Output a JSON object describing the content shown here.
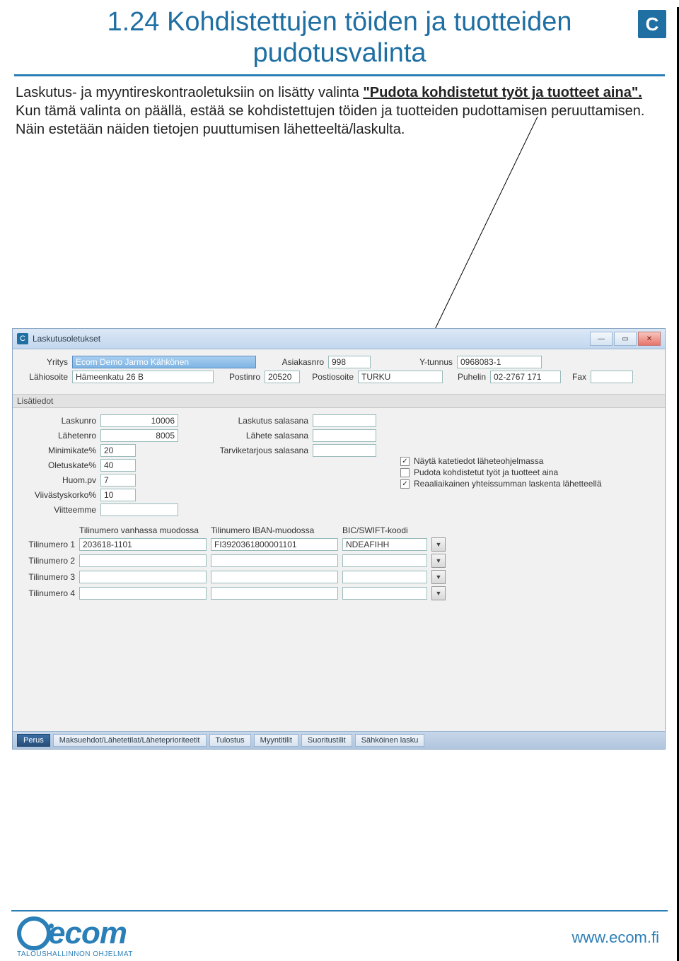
{
  "badge": "C",
  "title_line1": "1.24 Kohdistettujen töiden ja tuotteiden",
  "title_line2": "pudotusvalinta",
  "body": {
    "p1a": "Laskutus- ja myyntireskontraoletuksiin on lisätty valinta ",
    "p1b_boldunder": "\"Pudota kohdistetut työt ja tuotteet aina\".",
    "p2": "Kun tämä valinta on päällä, estää se kohdistettujen töiden ja tuotteiden pudottamisen peruuttamisen. Näin estetään näiden tietojen puuttumisen lähetteeltä/laskulta."
  },
  "window": {
    "title_icon": "C",
    "title": "Laskutusoletukset",
    "top": {
      "labels": {
        "yritys": "Yritys",
        "asiakasnro": "Asiakasnro",
        "ytunnus": "Y-tunnus",
        "lahiosoite": "Lähiosoite",
        "postinro": "Postinro",
        "postiosoite": "Postiosoite",
        "puhelin": "Puhelin",
        "fax": "Fax"
      },
      "values": {
        "yritys": "Ecom Demo Jarmo Kähkönen",
        "asiakasnro": "998",
        "ytunnus": "0968083-1",
        "lahiosoite": "Hämeenkatu 26 B",
        "postinro": "20520",
        "postiosoite": "TURKU",
        "puhelin": "02-2767 171",
        "fax": ""
      }
    },
    "section_lisatiedot": "Lisätiedot",
    "lisatiedot": {
      "labels": {
        "laskunro": "Laskunro",
        "lahetenro": "Lähetenro",
        "minimikate": "Minimikate%",
        "oletuskate": "Oletuskate%",
        "huompv": "Huom.pv",
        "viivastyskorko": "Viivästyskorko%",
        "viitteemme": "Viitteemme",
        "laskutus_salasana": "Laskutus salasana",
        "lahete_salasana": "Lähete salasana",
        "tarviketarjous_salasana": "Tarviketarjous salasana"
      },
      "values": {
        "laskunro": "10006",
        "lahetenro": "8005",
        "minimikate": "20",
        "oletuskate": "40",
        "huompv": "7",
        "viivastyskorko": "10",
        "viitteemme": "",
        "laskutus_salasana": "",
        "lahete_salasana": "",
        "tarviketarjous_salasana": ""
      },
      "checks": {
        "kate_checked": true,
        "kate_label": "Näytä katetiedot läheteohjelmassa",
        "pudota_checked": false,
        "pudota_label": "Pudota kohdistetut työt ja tuotteet aina",
        "reaali_checked": true,
        "reaali_label": "Reaaliaikainen yhteissumman laskenta lähetteellä"
      }
    },
    "bank": {
      "col_headers": {
        "vanha": "Tilinumero vanhassa muodossa",
        "iban": "Tilinumero IBAN-muodossa",
        "bic": "BIC/SWIFT-koodi"
      },
      "rows": [
        {
          "label": "Tilinumero 1",
          "vanha": "203618-1101",
          "iban": "FI3920361800001101",
          "bic": "NDEAFIHH"
        },
        {
          "label": "Tilinumero 2",
          "vanha": "",
          "iban": "",
          "bic": ""
        },
        {
          "label": "Tilinumero 3",
          "vanha": "",
          "iban": "",
          "bic": ""
        },
        {
          "label": "Tilinumero 4",
          "vanha": "",
          "iban": "",
          "bic": ""
        }
      ]
    },
    "tabs": [
      {
        "label": "Perus",
        "active": true
      },
      {
        "label": "Maksuehdot/Lähetetilat/Läheteprioriteetit",
        "active": false
      },
      {
        "label": "Tulostus",
        "active": false
      },
      {
        "label": "Myyntitilit",
        "active": false
      },
      {
        "label": "Suoritustilit",
        "active": false
      },
      {
        "label": "Sähköinen lasku",
        "active": false
      }
    ]
  },
  "footer": {
    "logo_text": "ecom",
    "logo_sub": "TALOUSHALLINNON OHJELMAT",
    "url": "www.ecom.fi"
  },
  "glyph": {
    "check": "✓",
    "min": "—",
    "restore": "▭",
    "close": "✕",
    "dd": "▼"
  }
}
